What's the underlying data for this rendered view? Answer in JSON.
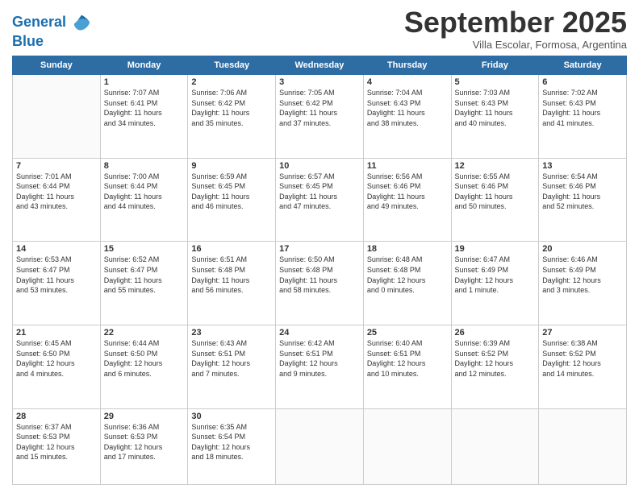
{
  "header": {
    "logo_line1": "General",
    "logo_line2": "Blue",
    "month_title": "September 2025",
    "subtitle": "Villa Escolar, Formosa, Argentina"
  },
  "days_of_week": [
    "Sunday",
    "Monday",
    "Tuesday",
    "Wednesday",
    "Thursday",
    "Friday",
    "Saturday"
  ],
  "weeks": [
    [
      {
        "day": "",
        "info": ""
      },
      {
        "day": "1",
        "info": "Sunrise: 7:07 AM\nSunset: 6:41 PM\nDaylight: 11 hours\nand 34 minutes."
      },
      {
        "day": "2",
        "info": "Sunrise: 7:06 AM\nSunset: 6:42 PM\nDaylight: 11 hours\nand 35 minutes."
      },
      {
        "day": "3",
        "info": "Sunrise: 7:05 AM\nSunset: 6:42 PM\nDaylight: 11 hours\nand 37 minutes."
      },
      {
        "day": "4",
        "info": "Sunrise: 7:04 AM\nSunset: 6:43 PM\nDaylight: 11 hours\nand 38 minutes."
      },
      {
        "day": "5",
        "info": "Sunrise: 7:03 AM\nSunset: 6:43 PM\nDaylight: 11 hours\nand 40 minutes."
      },
      {
        "day": "6",
        "info": "Sunrise: 7:02 AM\nSunset: 6:43 PM\nDaylight: 11 hours\nand 41 minutes."
      }
    ],
    [
      {
        "day": "7",
        "info": "Sunrise: 7:01 AM\nSunset: 6:44 PM\nDaylight: 11 hours\nand 43 minutes."
      },
      {
        "day": "8",
        "info": "Sunrise: 7:00 AM\nSunset: 6:44 PM\nDaylight: 11 hours\nand 44 minutes."
      },
      {
        "day": "9",
        "info": "Sunrise: 6:59 AM\nSunset: 6:45 PM\nDaylight: 11 hours\nand 46 minutes."
      },
      {
        "day": "10",
        "info": "Sunrise: 6:57 AM\nSunset: 6:45 PM\nDaylight: 11 hours\nand 47 minutes."
      },
      {
        "day": "11",
        "info": "Sunrise: 6:56 AM\nSunset: 6:46 PM\nDaylight: 11 hours\nand 49 minutes."
      },
      {
        "day": "12",
        "info": "Sunrise: 6:55 AM\nSunset: 6:46 PM\nDaylight: 11 hours\nand 50 minutes."
      },
      {
        "day": "13",
        "info": "Sunrise: 6:54 AM\nSunset: 6:46 PM\nDaylight: 11 hours\nand 52 minutes."
      }
    ],
    [
      {
        "day": "14",
        "info": "Sunrise: 6:53 AM\nSunset: 6:47 PM\nDaylight: 11 hours\nand 53 minutes."
      },
      {
        "day": "15",
        "info": "Sunrise: 6:52 AM\nSunset: 6:47 PM\nDaylight: 11 hours\nand 55 minutes."
      },
      {
        "day": "16",
        "info": "Sunrise: 6:51 AM\nSunset: 6:48 PM\nDaylight: 11 hours\nand 56 minutes."
      },
      {
        "day": "17",
        "info": "Sunrise: 6:50 AM\nSunset: 6:48 PM\nDaylight: 11 hours\nand 58 minutes."
      },
      {
        "day": "18",
        "info": "Sunrise: 6:48 AM\nSunset: 6:48 PM\nDaylight: 12 hours\nand 0 minutes."
      },
      {
        "day": "19",
        "info": "Sunrise: 6:47 AM\nSunset: 6:49 PM\nDaylight: 12 hours\nand 1 minute."
      },
      {
        "day": "20",
        "info": "Sunrise: 6:46 AM\nSunset: 6:49 PM\nDaylight: 12 hours\nand 3 minutes."
      }
    ],
    [
      {
        "day": "21",
        "info": "Sunrise: 6:45 AM\nSunset: 6:50 PM\nDaylight: 12 hours\nand 4 minutes."
      },
      {
        "day": "22",
        "info": "Sunrise: 6:44 AM\nSunset: 6:50 PM\nDaylight: 12 hours\nand 6 minutes."
      },
      {
        "day": "23",
        "info": "Sunrise: 6:43 AM\nSunset: 6:51 PM\nDaylight: 12 hours\nand 7 minutes."
      },
      {
        "day": "24",
        "info": "Sunrise: 6:42 AM\nSunset: 6:51 PM\nDaylight: 12 hours\nand 9 minutes."
      },
      {
        "day": "25",
        "info": "Sunrise: 6:40 AM\nSunset: 6:51 PM\nDaylight: 12 hours\nand 10 minutes."
      },
      {
        "day": "26",
        "info": "Sunrise: 6:39 AM\nSunset: 6:52 PM\nDaylight: 12 hours\nand 12 minutes."
      },
      {
        "day": "27",
        "info": "Sunrise: 6:38 AM\nSunset: 6:52 PM\nDaylight: 12 hours\nand 14 minutes."
      }
    ],
    [
      {
        "day": "28",
        "info": "Sunrise: 6:37 AM\nSunset: 6:53 PM\nDaylight: 12 hours\nand 15 minutes."
      },
      {
        "day": "29",
        "info": "Sunrise: 6:36 AM\nSunset: 6:53 PM\nDaylight: 12 hours\nand 17 minutes."
      },
      {
        "day": "30",
        "info": "Sunrise: 6:35 AM\nSunset: 6:54 PM\nDaylight: 12 hours\nand 18 minutes."
      },
      {
        "day": "",
        "info": ""
      },
      {
        "day": "",
        "info": ""
      },
      {
        "day": "",
        "info": ""
      },
      {
        "day": "",
        "info": ""
      }
    ]
  ]
}
